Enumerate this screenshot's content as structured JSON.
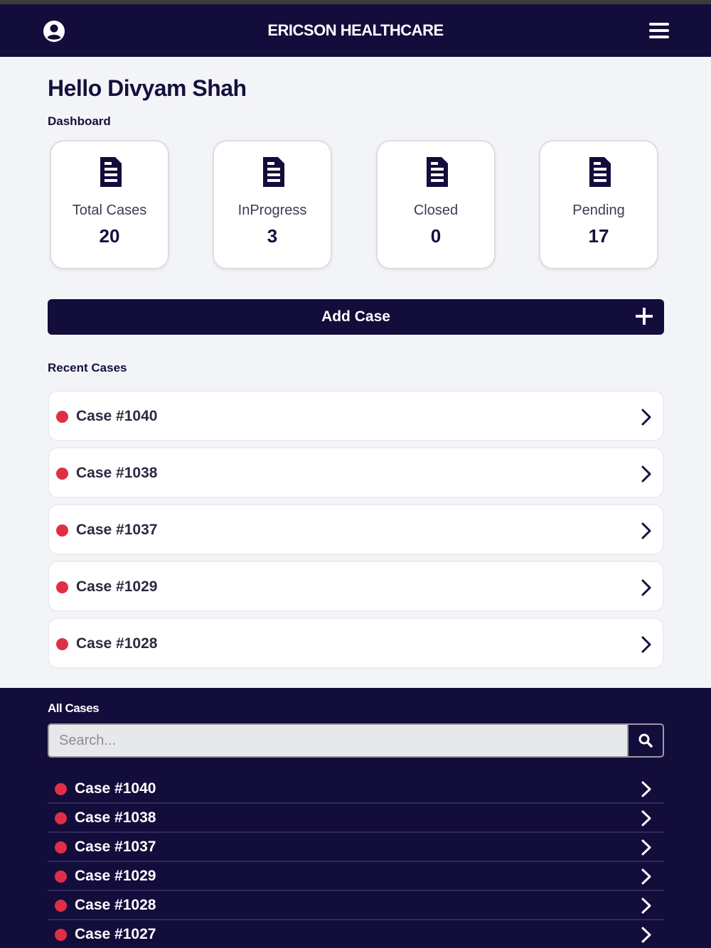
{
  "header": {
    "title": "ERICSON HEALTHCARE",
    "user_icon": "user-circle-icon",
    "menu_icon": "hamburger-menu-icon"
  },
  "greeting": "Hello Divyam Shah",
  "dashboard": {
    "label": "Dashboard",
    "cards": [
      {
        "label": "Total Cases",
        "value": "20",
        "icon": "document-icon"
      },
      {
        "label": "InProgress",
        "value": "3",
        "icon": "document-icon"
      },
      {
        "label": "Closed",
        "value": "0",
        "icon": "document-icon"
      },
      {
        "label": "Pending",
        "value": "17",
        "icon": "document-icon"
      }
    ]
  },
  "add_case": {
    "label": "Add Case",
    "icon": "plus-icon"
  },
  "recent_cases": {
    "label": "Recent Cases",
    "items": [
      {
        "name": "Case #1040"
      },
      {
        "name": "Case #1038"
      },
      {
        "name": "Case #1037"
      },
      {
        "name": "Case #1029"
      },
      {
        "name": "Case #1028"
      }
    ]
  },
  "all_cases": {
    "label": "All Cases",
    "search": {
      "placeholder": "Search...",
      "value": "",
      "icon": "search-icon"
    },
    "items": [
      {
        "name": "Case #1040"
      },
      {
        "name": "Case #1038"
      },
      {
        "name": "Case #1037"
      },
      {
        "name": "Case #1029"
      },
      {
        "name": "Case #1028"
      },
      {
        "name": "Case #1027"
      }
    ]
  },
  "colors": {
    "navy": "#130d3c",
    "status_dot": "#e02f45",
    "background": "#f3f4f7"
  }
}
